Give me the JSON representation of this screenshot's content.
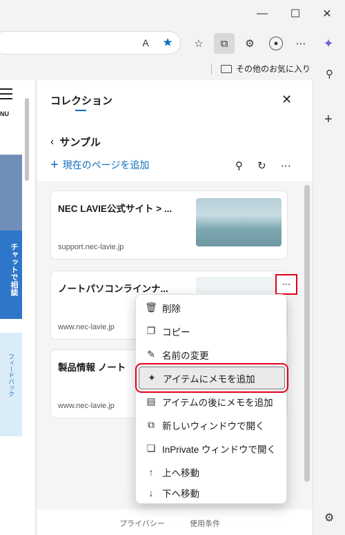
{
  "browser": {
    "window_controls": [
      "minimize",
      "maximize",
      "close"
    ],
    "read_aloud_label": "A",
    "favorites_folder": "その他のお気に入り"
  },
  "webpage": {
    "menu_label": "NU",
    "chat_text": "チャットで相談",
    "feedback_text": "フィードバック"
  },
  "collections": {
    "title": "コレクション",
    "collection_name": "サンプル",
    "add_current_page": "現在のページを追加",
    "items": [
      {
        "title": "NEC LAVIE公式サイト > ...",
        "url": "support.nec-lavie.jp"
      },
      {
        "title": "ノートパソコンラインナ...",
        "url": "www.nec-lavie.jp"
      },
      {
        "title": "製品情報 ノート",
        "url": "www.nec-lavie.jp"
      }
    ],
    "footer": {
      "privacy": "プライバシー",
      "terms": "使用条件"
    }
  },
  "context_menu": {
    "items": [
      {
        "label": "削除",
        "icon": "trash-icon"
      },
      {
        "label": "コピー",
        "icon": "copy-icon"
      },
      {
        "label": "名前の変更",
        "icon": "pencil-icon"
      },
      {
        "label": "アイテムにメモを追加",
        "icon": "note-add-icon"
      },
      {
        "label": "アイテムの後にメモを追加",
        "icon": "note-after-icon"
      },
      {
        "label": "新しいウィンドウで開く",
        "icon": "new-window-icon"
      },
      {
        "label": "InPrivate ウィンドウで開く",
        "icon": "inprivate-icon"
      },
      {
        "label": "上へ移動",
        "icon": "arrow-up-icon"
      },
      {
        "label": "下へ移動",
        "icon": "arrow-down-icon"
      }
    ],
    "highlighted_index": 3
  },
  "colors": {
    "accent": "#0f6cbd",
    "highlight_border": "#e0001a"
  }
}
